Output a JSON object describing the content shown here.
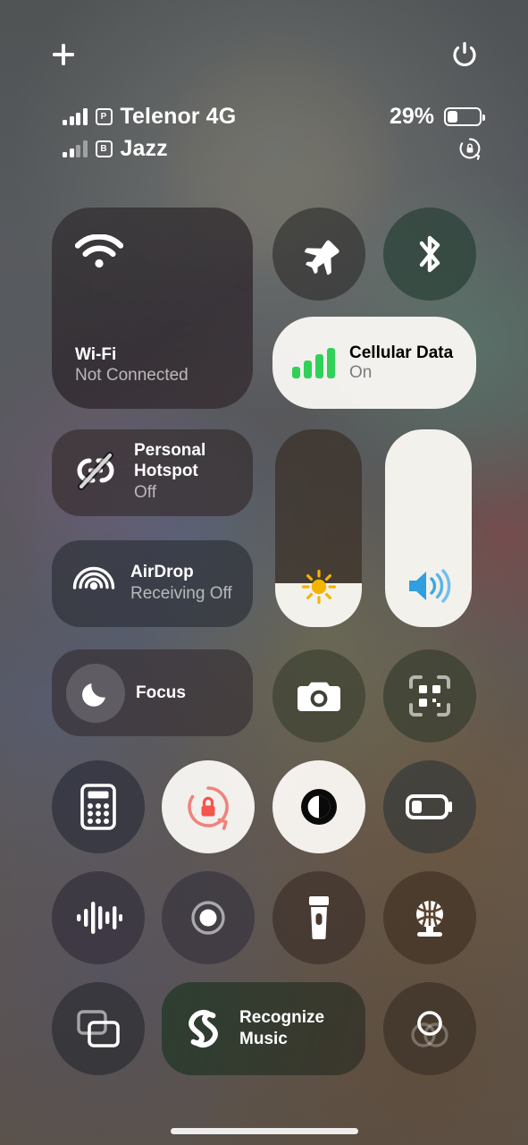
{
  "screen": {
    "name": "iOS Control Center"
  },
  "topbar": {
    "add_label": "+",
    "add_icon": "plus-icon",
    "power_icon": "power-icon"
  },
  "status": {
    "line1": {
      "signal_icon": "cellular-signal-bars-icon",
      "signal_bars": 4,
      "sim_badge": "P",
      "carrier": "Telenor 4G",
      "battery_percent": "29%",
      "battery_level": 29,
      "battery_icon": "battery-icon"
    },
    "line2": {
      "signal_icon": "cellular-signal-bars-icon",
      "signal_bars": 2,
      "sim_badge": "B",
      "carrier": "Jazz",
      "rotation_lock_icon": "rotation-lock-icon"
    }
  },
  "controls": {
    "wifi": {
      "icon": "wifi-icon",
      "title": "Wi-Fi",
      "status": "Not Connected",
      "state": "off"
    },
    "airplane": {
      "icon": "airplane-icon",
      "label": "Airplane Mode",
      "state": "off"
    },
    "bluetooth": {
      "icon": "bluetooth-icon",
      "label": "Bluetooth",
      "state": "off"
    },
    "cellular": {
      "icon": "cellular-data-bars-icon",
      "title": "Cellular Data",
      "status": "On",
      "state": "on"
    },
    "hotspot": {
      "icon": "personal-hotspot-off-icon",
      "title": "Personal Hotspot",
      "status": "Off",
      "state": "off"
    },
    "airdrop": {
      "icon": "airdrop-icon",
      "title": "AirDrop",
      "status": "Receiving Off",
      "state": "off"
    },
    "brightness": {
      "icon": "brightness-sun-icon",
      "label": "Brightness",
      "value": 22
    },
    "volume": {
      "icon": "volume-speaker-icon",
      "label": "Volume",
      "value": 100
    },
    "focus": {
      "icon": "moon-icon",
      "label": "Focus",
      "state": "off"
    },
    "camera": {
      "icon": "camera-icon",
      "label": "Camera"
    },
    "qr_scanner": {
      "icon": "qr-code-scanner-icon",
      "label": "Code Scanner"
    },
    "calculator": {
      "icon": "calculator-icon",
      "label": "Calculator"
    },
    "rotation_lock": {
      "icon": "rotation-lock-icon",
      "label": "Rotation Lock",
      "state": "on"
    },
    "dark_mode": {
      "icon": "dark-mode-icon",
      "label": "Dark Mode",
      "state": "on"
    },
    "low_power": {
      "icon": "low-power-battery-icon",
      "label": "Low Power Mode",
      "state": "off"
    },
    "voice_memos": {
      "icon": "voice-memos-waveform-icon",
      "label": "Voice Memos"
    },
    "screen_record": {
      "icon": "screen-record-icon",
      "label": "Screen Recording"
    },
    "flashlight": {
      "icon": "flashlight-icon",
      "label": "Flashlight",
      "state": "off"
    },
    "hearing": {
      "icon": "hearing-icon",
      "label": "Hearing"
    },
    "screen_mirroring": {
      "icon": "screen-mirroring-icon",
      "label": "Screen Mirroring"
    },
    "shazam": {
      "icon": "shazam-icon",
      "label": "Recognize Music"
    },
    "rings": {
      "icon": "overlapping-rings-icon",
      "label": "Accessibility Rings"
    }
  },
  "colors": {
    "accent_green": "#30d158",
    "volume_blue": "#2f9fe0",
    "brightness_yellow": "#f5b400",
    "rotation_red": "#f0635c",
    "tile_on_bg": "#fcfaf7",
    "tile_off_bg": "rgba(38,36,38,0.58)",
    "text_primary": "#ffffff",
    "text_secondary": "rgba(235,235,235,0.72)"
  },
  "home_indicator": {
    "name": "home-indicator"
  }
}
